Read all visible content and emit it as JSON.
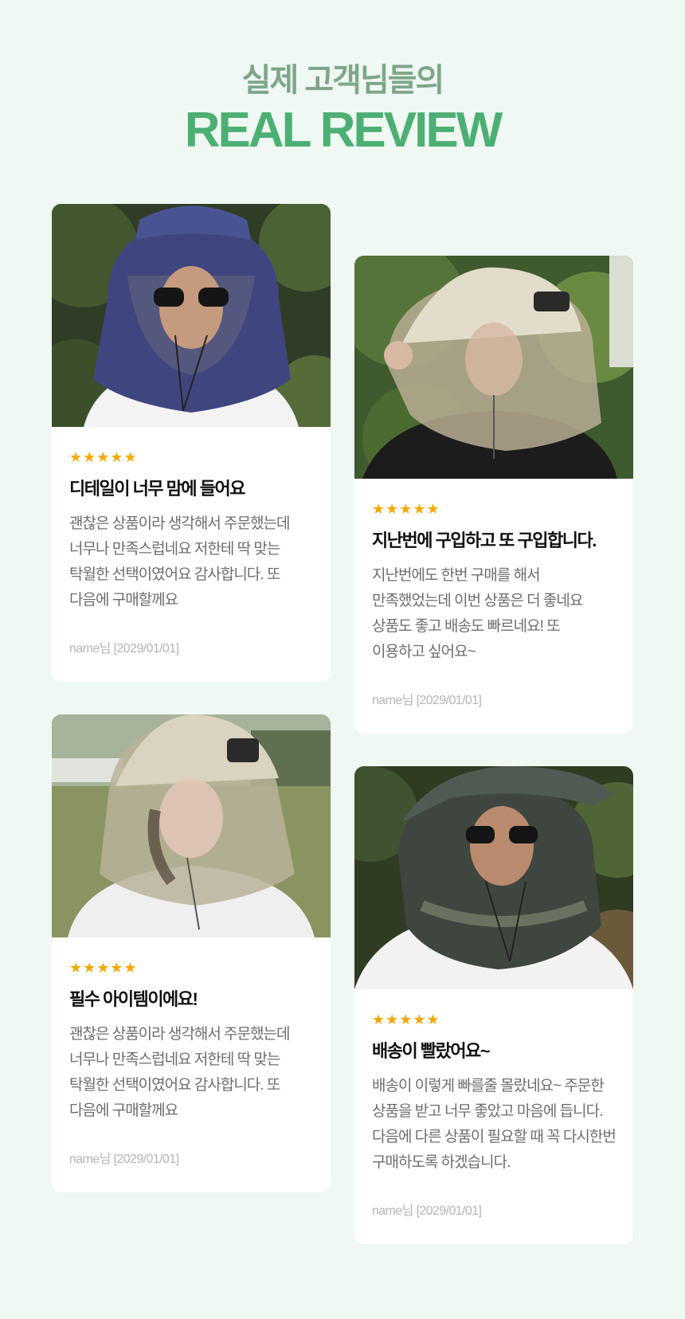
{
  "header": {
    "subtitle": "실제 고객님들의",
    "title": "REAL REVIEW"
  },
  "colors": {
    "background": "#f0f8f3",
    "title_green": "#4caf73",
    "subtitle_green": "#7fa68a",
    "star": "#f5a800"
  },
  "reviews": [
    {
      "rating": 5,
      "stars": "★★★★★",
      "title": "디테일이 너무 맘에 들어요",
      "text": "괜찮은 상품이라 생각해서 주문했는데\n너무나 만족스럽네요 저한테 딱 맞는\n탁월한 선택이였어요 감사합니다. 또\n다음에 구매할께요",
      "meta": "name님 [2029/01/01]",
      "photo": "man-navy-mosquito-net-hat"
    },
    {
      "rating": 5,
      "stars": "★★★★★",
      "title": "지난번에 구입하고 또 구입합니다.",
      "text": "지난번에도 한번 구매를 해서\n만족했었는데 이번 상품은 더 좋네요\n상품도 좋고 배송도 빠르네요! 또\n이용하고 싶어요~",
      "meta": "name님 [2029/01/01]",
      "photo": "woman-beige-mosquito-net-hat"
    },
    {
      "rating": 5,
      "stars": "★★★★★",
      "title": "필수 아이템이에요!",
      "text": "괜찮은 상품이라 생각해서 주문했는데\n너무나 만족스럽네요 저한테 딱 맞는\n탁월한 선택이였어요 감사합니다. 또\n다음에 구매할께요",
      "meta": "name님 [2029/01/01]",
      "photo": "woman-beige-mosquito-net-hat-field"
    },
    {
      "rating": 5,
      "stars": "★★★★★",
      "title": "배송이 빨랐어요~",
      "text": "배송이 이렇게 빠를줄 몰랐네요~ 주문한\n상품을 받고 너무 좋았고 마음에 듭니다.\n다음에 다른 상품이 필요할 때 꼭 다시한번\n구매하도록 하겠습니다.",
      "meta": "name님 [2029/01/01]",
      "photo": "man-gray-mosquito-net-hat"
    }
  ]
}
